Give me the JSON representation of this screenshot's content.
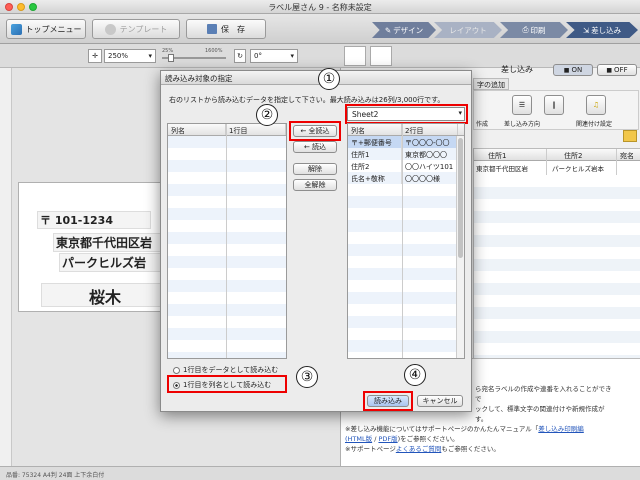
{
  "window": {
    "title": "ラベル屋さん 9 - 名称未設定"
  },
  "toolbar": {
    "top_menu": "トップメニュー",
    "template": "テンプレート",
    "save": "保　存",
    "zoom": "250%",
    "rotate": "0°",
    "slider_min": "25%",
    "slider_max": "1600%",
    "modes": [
      "デザイン",
      "レイアウト",
      "印刷",
      "差し込み"
    ]
  },
  "merge_panel": {
    "label": "差し込み",
    "on": "ON",
    "off": "OFF",
    "tab_add": "字の追加",
    "tool_create": "作成",
    "tool_direction": "差し込み方向",
    "tool_related": "関連付け設定",
    "columns": [
      "住所1",
      "住所2",
      "宛名"
    ],
    "row1": [
      "東京都千代田区岩",
      "パークヒルズ岩本",
      ""
    ],
    "help_lines": [
      "ら宛名ラベルの作成や連番を入れることができ",
      "で",
      "ックして、標準文字の関連付けや新規作成が",
      "す。"
    ],
    "help_link1_prefix": "※差し込み機能についてはサポートページのかんたんマニュアル「",
    "help_link1": "差し込み印刷編",
    "help_link2_a": "(HTML版",
    "help_link2_sep": " / ",
    "help_link2_b": "PDF版",
    "help_link2_suffix": ")をご参照ください。",
    "help_faq_prefix": "※サポートページ",
    "help_faq_link": "よくあるご質問",
    "help_faq_suffix": "もご参照ください。"
  },
  "label_preview": {
    "postal": "〒 101-1234",
    "address1": "東京都千代田区岩",
    "address2": "パークヒルズ岩",
    "name": "桜木"
  },
  "dialog": {
    "title": "読み込み対象の指定",
    "instruction": "右のリストから読み込むデータを指定して下さい。最大読み込みは26列/3,000行です。",
    "sheet": "Sheet2",
    "left_list": {
      "headers": [
        "列名",
        "1行目"
      ]
    },
    "right_list": {
      "headers": [
        "列名",
        "2行目"
      ],
      "rows": [
        [
          "〒+郵便番号",
          "〒〇〇〇-〇〇"
        ],
        [
          "住所1",
          "東京都〇〇〇"
        ],
        [
          "住所2",
          "〇〇ハイツ101"
        ],
        [
          "氏名+敬称",
          "〇〇〇〇様"
        ]
      ]
    },
    "buttons": {
      "load_all": "← 全読込",
      "load": "← 読込",
      "remove": "解除",
      "remove_all": "全解除",
      "ok": "読み込み",
      "cancel": "キャンセル"
    },
    "radio_data": "1行目をデータとして読み込む",
    "radio_header": "1行目を列名として読み込む"
  },
  "annotations": [
    "①",
    "②",
    "③",
    "④"
  ],
  "status": {
    "text": "品番: 75324 A4判 24面 上下余白付"
  }
}
